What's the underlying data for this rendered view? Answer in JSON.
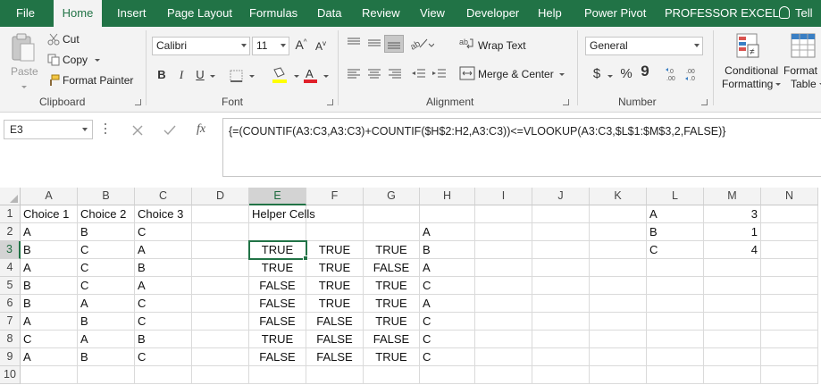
{
  "tabs": [
    {
      "label": "File",
      "active": false
    },
    {
      "label": "Home",
      "active": true
    },
    {
      "label": "Insert",
      "active": false
    },
    {
      "label": "Page Layout",
      "active": false
    },
    {
      "label": "Formulas",
      "active": false
    },
    {
      "label": "Data",
      "active": false
    },
    {
      "label": "Review",
      "active": false
    },
    {
      "label": "View",
      "active": false
    },
    {
      "label": "Developer",
      "active": false
    },
    {
      "label": "Help",
      "active": false
    },
    {
      "label": "Power Pivot",
      "active": false
    },
    {
      "label": "PROFESSOR EXCEL",
      "active": false
    },
    {
      "label": "Tell",
      "active": false
    }
  ],
  "ribbon": {
    "clipboard": {
      "paste": "Paste",
      "cut": "Cut",
      "copy": "Copy",
      "format_painter": "Format Painter",
      "label": "Clipboard"
    },
    "font": {
      "name": "Calibri",
      "size": "11",
      "bold": "B",
      "italic": "I",
      "underline": "U",
      "label": "Font"
    },
    "alignment": {
      "wrap_text": "Wrap Text",
      "merge_center": "Merge & Center",
      "label": "Alignment"
    },
    "number": {
      "format": "General",
      "currency": "$",
      "percent": "%",
      "comma": "9",
      "label": "Number"
    },
    "styles": {
      "conditional_formatting_line1": "Conditional",
      "conditional_formatting_line2": "Formatting",
      "format_table_line1": "Format",
      "format_table_line2": "Table"
    }
  },
  "formula_bar": {
    "name_box": "E3",
    "fx": "fx",
    "formula": "{=(COUNTIF(A3:C3,A3:C3)+COUNTIF($H$2:H2,A3:C3))<=VLOOKUP(A3:C3,$L$1:$M$3,2,FALSE)}"
  },
  "colors": {
    "accent": "#217346",
    "ribbon_bg": "#f3f3f3"
  },
  "sheet": {
    "columns": [
      "A",
      "B",
      "C",
      "D",
      "E",
      "F",
      "G",
      "H",
      "I",
      "J",
      "K",
      "L",
      "M",
      "N"
    ],
    "rows": [
      "1",
      "2",
      "3",
      "4",
      "5",
      "6",
      "7",
      "8",
      "9",
      "10"
    ],
    "active_cell": "E3",
    "cells": {
      "A1": "Choice 1",
      "B1": "Choice 2",
      "C1": "Choice 3",
      "E1": "Helper Cells",
      "L1": "A",
      "M1": "3",
      "A2": "A",
      "B2": "B",
      "C2": "C",
      "H2": "A",
      "L2": "B",
      "M2": "1",
      "A3": "B",
      "B3": "C",
      "C3": "A",
      "E3": "TRUE",
      "F3": "TRUE",
      "G3": "TRUE",
      "H3": "B",
      "L3": "C",
      "M3": "4",
      "A4": "A",
      "B4": "C",
      "C4": "B",
      "E4": "TRUE",
      "F4": "TRUE",
      "G4": "FALSE",
      "H4": "A",
      "A5": "B",
      "B5": "C",
      "C5": "A",
      "E5": "FALSE",
      "F5": "TRUE",
      "G5": "TRUE",
      "H5": "C",
      "A6": "B",
      "B6": "A",
      "C6": "C",
      "E6": "FALSE",
      "F6": "TRUE",
      "G6": "TRUE",
      "H6": "A",
      "A7": "A",
      "B7": "B",
      "C7": "C",
      "E7": "FALSE",
      "F7": "FALSE",
      "G7": "TRUE",
      "H7": "C",
      "A8": "C",
      "B8": "A",
      "C8": "B",
      "E8": "TRUE",
      "F8": "FALSE",
      "G8": "FALSE",
      "H8": "C",
      "A9": "A",
      "B9": "B",
      "C9": "C",
      "E9": "FALSE",
      "F9": "FALSE",
      "G9": "TRUE",
      "H9": "C"
    }
  }
}
